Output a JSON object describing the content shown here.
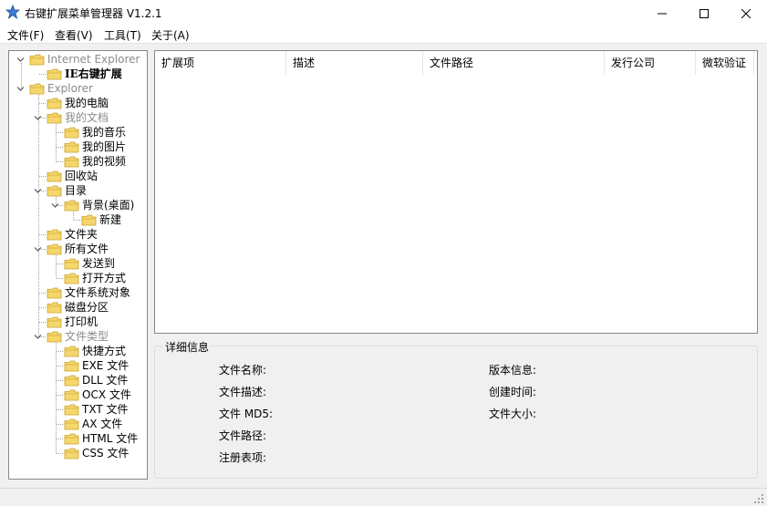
{
  "window": {
    "title": "右键扩展菜单管理器 V1.2.1",
    "icon": "star-app-icon",
    "controls": [
      "minimize-icon",
      "maximize-icon",
      "close-icon"
    ]
  },
  "menu": [
    "文件(F)",
    "查看(V)",
    "工具(T)",
    "关于(A)"
  ],
  "tree": [
    {
      "label": "Internet Explorer",
      "style": "gray",
      "expanded": true
    },
    {
      "label": "IE右键扩展",
      "style": "bold"
    },
    {
      "label": "Explorer",
      "style": "gray",
      "expanded": true
    },
    {
      "label": "我的电脑"
    },
    {
      "label": "我的文档",
      "style": "gray",
      "expanded": true
    },
    {
      "label": "我的音乐"
    },
    {
      "label": "我的图片"
    },
    {
      "label": "我的视频"
    },
    {
      "label": "回收站"
    },
    {
      "label": "目录",
      "expanded": true
    },
    {
      "label": "背景(桌面)",
      "expanded": true
    },
    {
      "label": "新建"
    },
    {
      "label": "文件夹"
    },
    {
      "label": "所有文件",
      "expanded": true
    },
    {
      "label": "发送到"
    },
    {
      "label": "打开方式"
    },
    {
      "label": "文件系统对象"
    },
    {
      "label": "磁盘分区"
    },
    {
      "label": "打印机"
    },
    {
      "label": "文件类型",
      "style": "gray",
      "expanded": true
    },
    {
      "label": "快捷方式"
    },
    {
      "label": "EXE 文件"
    },
    {
      "label": "DLL 文件"
    },
    {
      "label": "OCX 文件"
    },
    {
      "label": "TXT 文件"
    },
    {
      "label": "AX 文件"
    },
    {
      "label": "HTML 文件"
    },
    {
      "label": "CSS 文件"
    }
  ],
  "list": {
    "columns": [
      "扩展项",
      "描述",
      "文件路径",
      "发行公司",
      "微软验证"
    ],
    "rows": []
  },
  "details": {
    "title": "详细信息",
    "left": [
      "文件名称:",
      "文件描述:",
      "文件 MD5:",
      "文件路径:",
      "注册表项:"
    ],
    "right": [
      "版本信息:",
      "创建时间:",
      "文件大小:"
    ]
  },
  "colors": {
    "folder": "#f5d76e",
    "folder_edge": "#c9a227",
    "app_icon": "#3a7bd5"
  }
}
